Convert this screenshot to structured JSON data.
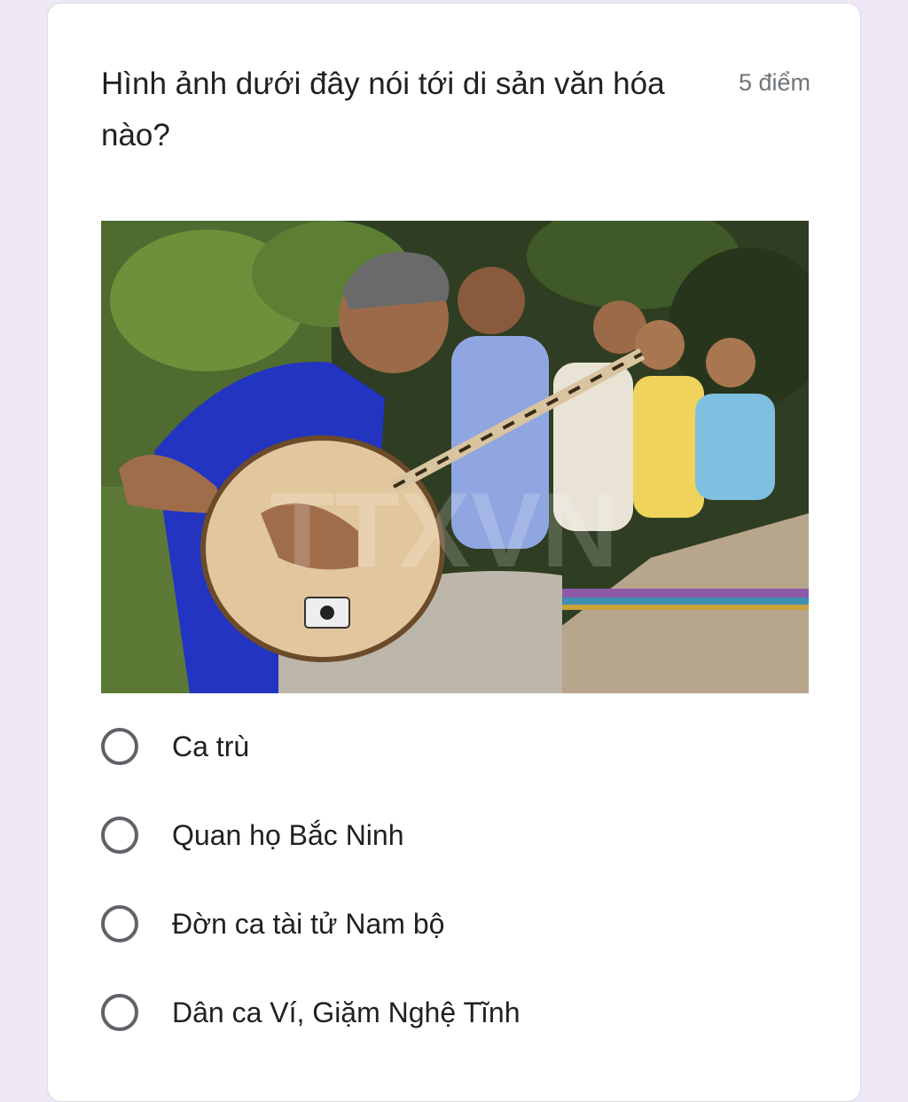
{
  "question": {
    "title": "Hình ảnh dưới đây nói tới di sản văn hóa nào?",
    "points": "5 điểm",
    "image": {
      "watermark": "TTXVN"
    },
    "options": [
      {
        "label": "Ca trù"
      },
      {
        "label": "Quan họ Bắc Ninh"
      },
      {
        "label": "Đờn ca tài tử Nam bộ"
      },
      {
        "label": "Dân ca Ví, Giặm Nghệ Tĩnh"
      }
    ]
  }
}
